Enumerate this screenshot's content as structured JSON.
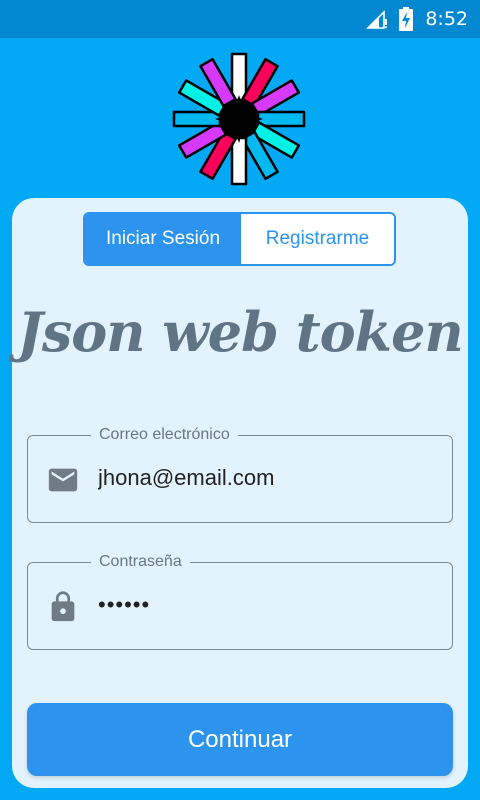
{
  "status_bar": {
    "time": "8:52",
    "icons": [
      "signal-icon",
      "battery-charging-icon"
    ]
  },
  "logo": {
    "name": "jwt-logo"
  },
  "tabs": [
    {
      "label": "Iniciar Sesión",
      "active": true
    },
    {
      "label": "Registrarme",
      "active": false
    }
  ],
  "title": "Json web token",
  "form": {
    "email": {
      "label": "Correo electrónico",
      "value": "jhona@email.com",
      "icon": "email-icon"
    },
    "password": {
      "label": "Contraseña",
      "value": "••••••",
      "icon": "lock-icon"
    }
  },
  "submit_label": "Continuar",
  "colors": {
    "background": "#03a9f4",
    "status_bar": "#0288d1",
    "card": "#e3f3fd",
    "primary": "#2c94ee",
    "title": "#5f7586"
  }
}
